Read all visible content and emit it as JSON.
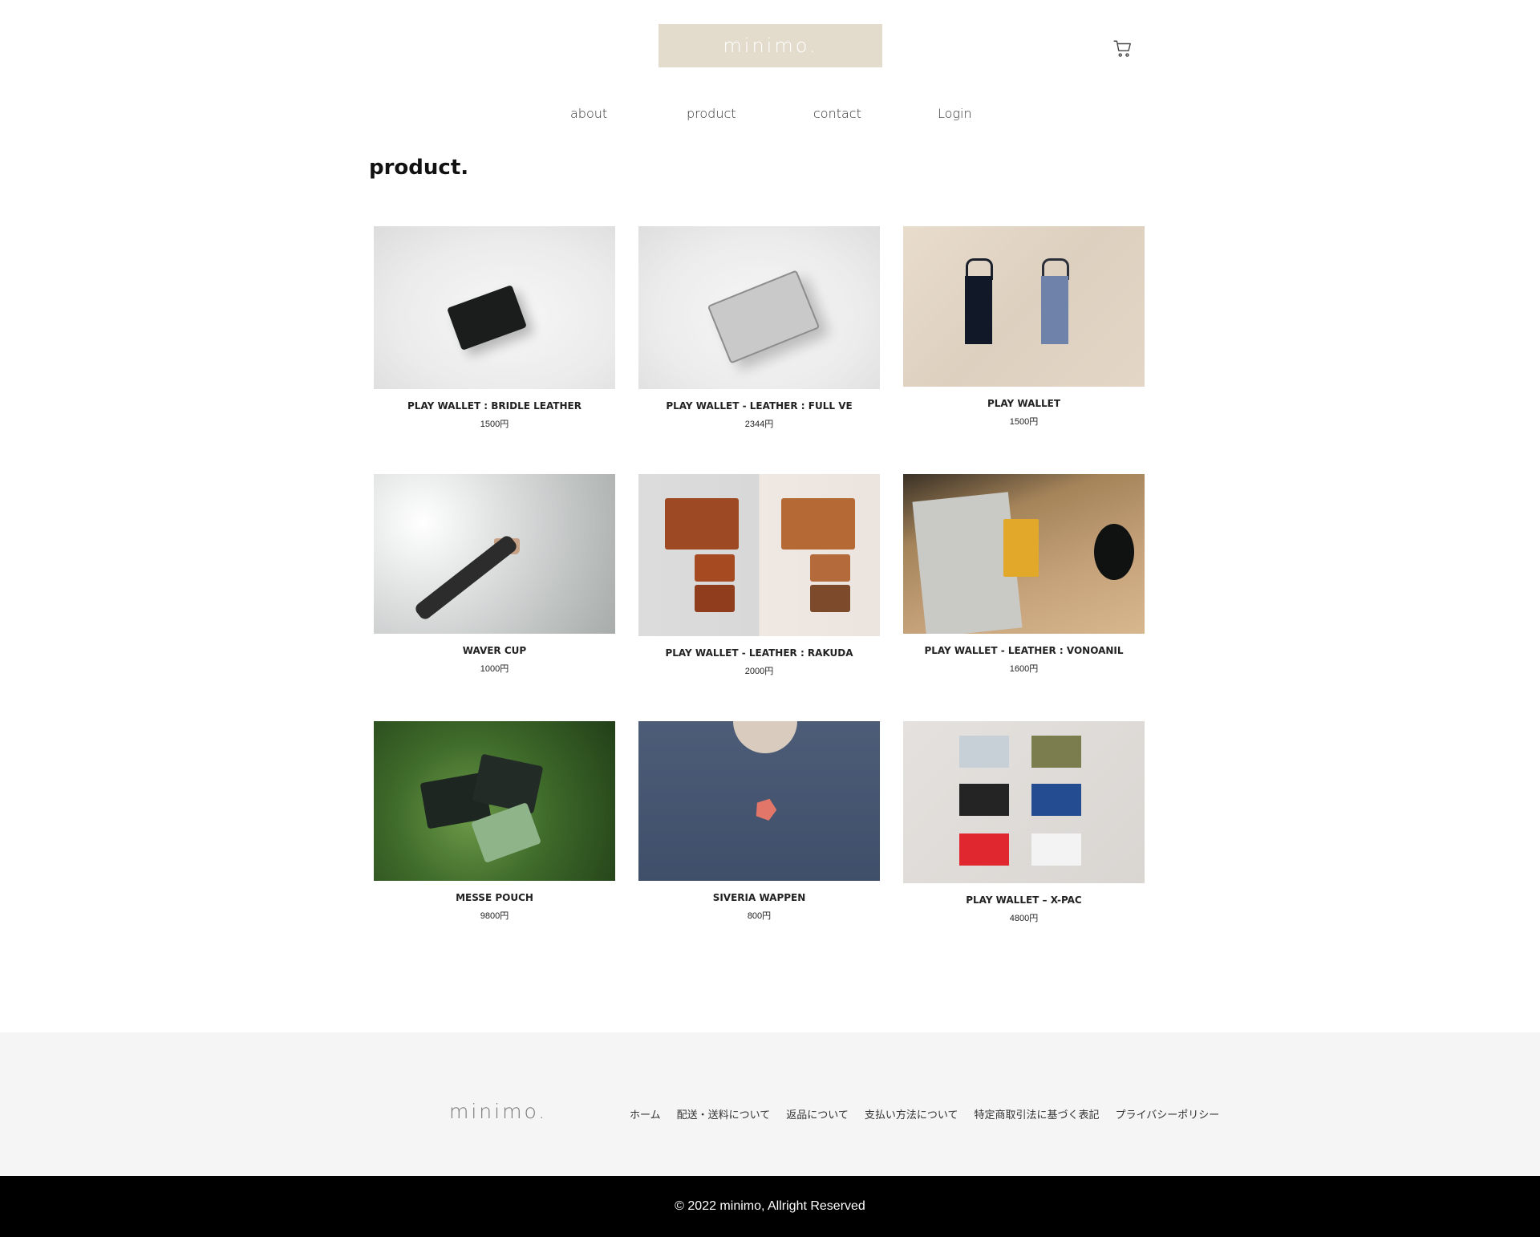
{
  "header": {
    "logo": "minimo.",
    "cart_icon": "cart-icon"
  },
  "nav": [
    {
      "label": "about"
    },
    {
      "label": "product"
    },
    {
      "label": "contact"
    },
    {
      "label": "Login"
    }
  ],
  "page_title": "product.",
  "products": [
    {
      "name": "PLAY WALLET : BRIDLE LEATHER",
      "price": "1500円"
    },
    {
      "name": "PLAY WALLET - LEATHER : FULL VE",
      "price": "2344円"
    },
    {
      "name": "PLAY WALLET",
      "price": "1500円"
    },
    {
      "name": "WAVER CUP",
      "price": "1000円"
    },
    {
      "name": "PLAY WALLET - LEATHER : RAKUDA",
      "price": "2000円"
    },
    {
      "name": "PLAY WALLET - LEATHER : VONOANIL",
      "price": "1600円"
    },
    {
      "name": "MESSE POUCH",
      "price": "9800円"
    },
    {
      "name": "SIVERIA WAPPEN",
      "price": "800円"
    },
    {
      "name": "PLAY WALLET – X-PAC",
      "price": "4800円"
    }
  ],
  "footer": {
    "logo": "minimo.",
    "links": [
      "ホーム",
      "配送・送料について",
      "返品について",
      "支払い方法について",
      "特定商取引法に基づく表記",
      "プライバシーポリシー"
    ],
    "copyright": "© 2022 minimo, Allright Reserved"
  }
}
